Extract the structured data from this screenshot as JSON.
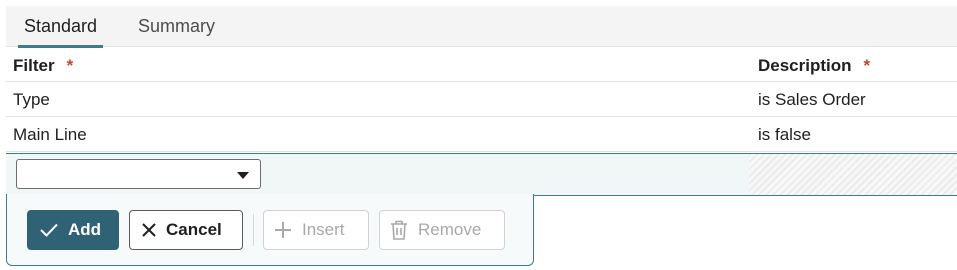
{
  "tabs": [
    {
      "label": "Standard",
      "active": true
    },
    {
      "label": "Summary",
      "active": false
    }
  ],
  "grid": {
    "headers": {
      "filter": "Filter",
      "description": "Description",
      "required_mark": "*"
    },
    "rows": [
      {
        "filter": "Type",
        "description": "is Sales Order"
      },
      {
        "filter": "Main Line",
        "description": "is false"
      }
    ]
  },
  "edit_row": {
    "filter_select_value": ""
  },
  "actions": {
    "add": "Add",
    "cancel": "Cancel",
    "insert": "Insert",
    "remove": "Remove"
  },
  "colors": {
    "accent": "#3b7d8f",
    "primary_button": "#2f6274",
    "required": "#c2452d"
  }
}
